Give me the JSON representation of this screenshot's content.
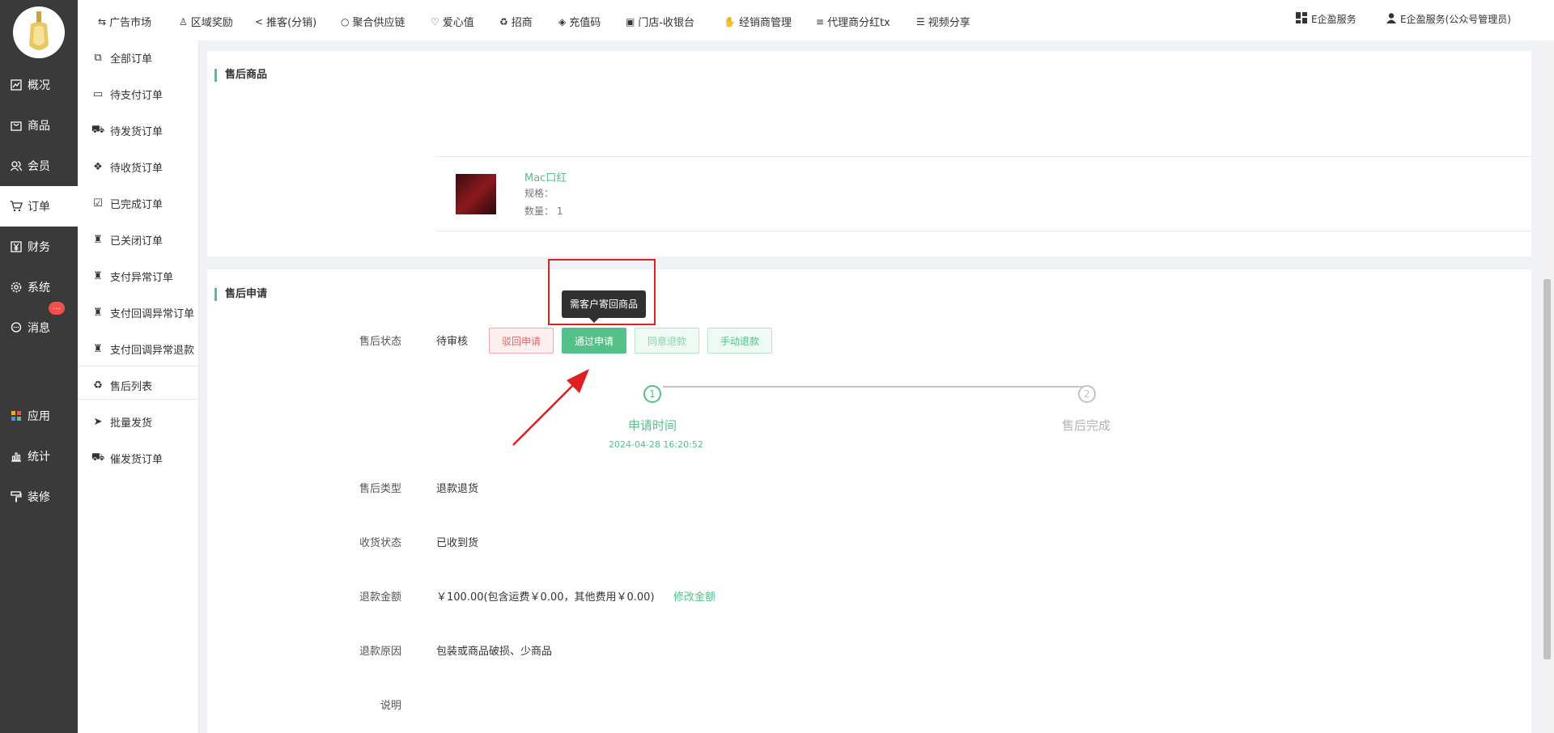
{
  "sidebar": {
    "items": [
      {
        "label": "概况",
        "icon": "chart-icon"
      },
      {
        "label": "商品",
        "icon": "bag-icon"
      },
      {
        "label": "会员",
        "icon": "users-icon"
      },
      {
        "label": "订单",
        "icon": "cart-icon"
      },
      {
        "label": "财务",
        "icon": "yen-icon"
      },
      {
        "label": "系统",
        "icon": "gear-icon"
      },
      {
        "label": "消息",
        "icon": "chat-icon",
        "badge": "..."
      },
      {
        "label": "应用",
        "icon": "grid-icon"
      },
      {
        "label": "统计",
        "icon": "bar-chart-icon"
      },
      {
        "label": "装修",
        "icon": "paint-roller-icon"
      }
    ],
    "active": "订单"
  },
  "submenu": {
    "items": [
      {
        "label": "全部订单",
        "icon": "copy-icon"
      },
      {
        "label": "待支付订单",
        "icon": "card-icon"
      },
      {
        "label": "待发货订单",
        "icon": "truck-icon"
      },
      {
        "label": "待收货订单",
        "icon": "dropbox-icon"
      },
      {
        "label": "已完成订单",
        "icon": "check-square-icon"
      },
      {
        "label": "已关闭订单",
        "icon": "cup-icon"
      },
      {
        "label": "支付异常订单",
        "icon": "cup-icon"
      },
      {
        "label": "支付回调异常订单",
        "icon": "cup-icon"
      },
      {
        "label": "支付回调异常退款",
        "icon": "cup-icon"
      },
      {
        "label": "售后列表",
        "icon": "recycle-icon"
      },
      {
        "label": "批量发货",
        "icon": "paper-plane-icon"
      },
      {
        "label": "催发货订单",
        "icon": "truck-icon"
      }
    ]
  },
  "topbar": {
    "links": [
      {
        "label": "广告市场",
        "icon": "retweet-icon"
      },
      {
        "label": "区域奖励",
        "icon": "child-icon"
      },
      {
        "label": "推客(分销)",
        "icon": "share-icon"
      },
      {
        "label": "聚合供应链",
        "icon": "circle-icon"
      },
      {
        "label": "爱心值",
        "icon": "heart-icon"
      },
      {
        "label": "招商",
        "icon": "recycle-icon"
      },
      {
        "label": "充值码",
        "icon": "tag-icon"
      },
      {
        "label": "门店-收银台",
        "icon": "money-icon"
      },
      {
        "label": "经销商管理",
        "icon": "handshake-icon"
      },
      {
        "label": "代理商分红tx",
        "icon": "bars-icon"
      },
      {
        "label": "视频分享",
        "icon": "list-icon"
      }
    ],
    "service": "E企盈服务",
    "user": "E企盈服务(公众号管理员)"
  },
  "aftersale_goods": {
    "title": "售后商品",
    "product": {
      "name": "Mac口红",
      "spec_label": "规格：",
      "qty_label": "数量：",
      "qty": "1"
    }
  },
  "aftersale_apply": {
    "title": "售后申请",
    "status_label": "售后状态",
    "status_value": "待审核",
    "buttons": {
      "reject": "驳回申请",
      "pass": "通过申请",
      "agree_refund": "同意退款",
      "manual_refund": "手动退款"
    },
    "tooltip": "需客户寄回商品",
    "steps": [
      {
        "num": "1",
        "title": "申请时间",
        "time": "2024-04-28 16:20:52"
      },
      {
        "num": "2",
        "title": "售后完成",
        "time": ""
      }
    ],
    "fields": [
      {
        "label": "售后类型",
        "value": "退款退货"
      },
      {
        "label": "收货状态",
        "value": "已收到货"
      },
      {
        "label": "退款金额",
        "value": "￥100.00(包含运费￥0.00，其他费用￥0.00)",
        "link": "修改金额"
      },
      {
        "label": "退款原因",
        "value": "包装或商品破损、少商品"
      },
      {
        "label": "说明",
        "value": ""
      }
    ]
  },
  "colors": {
    "accent": "#54c08a",
    "sidebar_bg": "#3a3a3a",
    "annotation_red": "#e02020"
  }
}
